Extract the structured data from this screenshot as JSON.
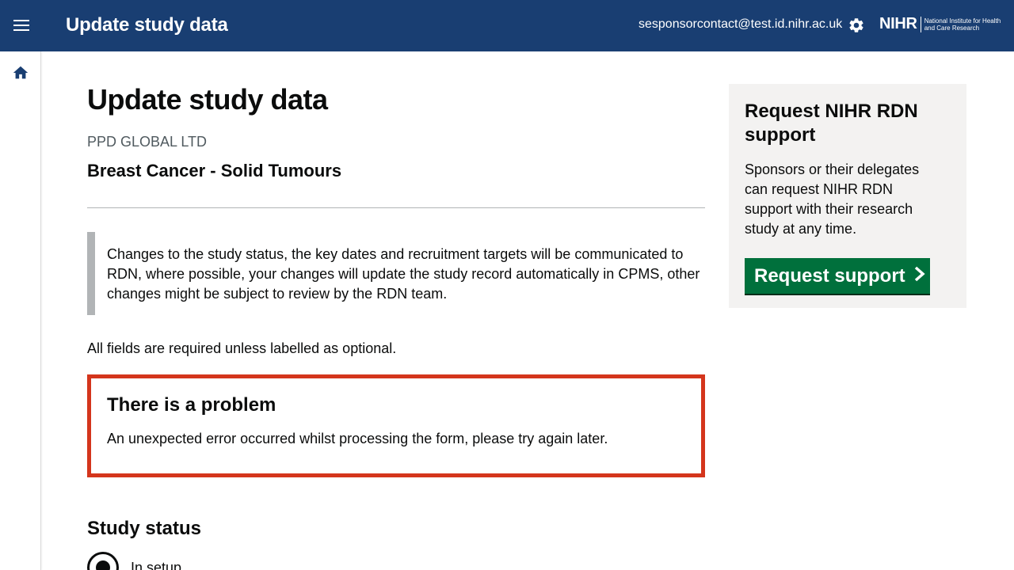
{
  "header": {
    "app_title": "Update study data",
    "user_email": "sesponsorcontact@test.id.nihr.ac.uk",
    "logo_main": "NIHR",
    "logo_sub": "National Institute for Health and Care Research",
    "bg_color": "#193e72",
    "icons": [
      "menu-icon",
      "gear-icon"
    ]
  },
  "nav": {
    "icons": [
      "home-icon"
    ]
  },
  "main": {
    "page_title": "Update study data",
    "org_name": "PPD GLOBAL LTD",
    "study_name": "Breast Cancer - Solid Tumours",
    "inset_text": "Changes to the study status, the key dates and recruitment targets will be communicated to RDN, where possible, your changes will update the study record automatically in CPMS, other changes might be subject to review by the RDN team.",
    "fields_note": "All fields are required unless labelled as optional.",
    "error": {
      "title": "There is a problem",
      "message": "An unexpected error occurred whilst processing the form, please try again later.",
      "border_color": "#d4351c"
    },
    "study_status": {
      "heading": "Study status",
      "options": [
        {
          "label": "In setup",
          "selected": true
        }
      ]
    }
  },
  "support_panel": {
    "title": "Request NIHR RDN support",
    "text": "Sponsors or their delegates can request NIHR RDN support with their research study at any time.",
    "button_label": "Request support",
    "button_color": "#00703c",
    "icons": [
      "chevron-right-icon"
    ]
  }
}
